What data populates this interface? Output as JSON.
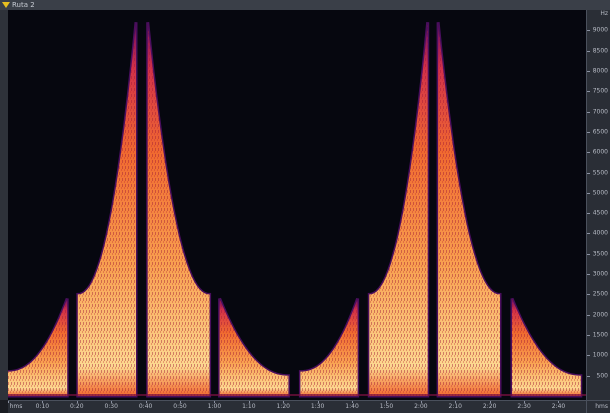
{
  "window": {
    "title": "Ruta 2",
    "icon": "triangle-marker-icon"
  },
  "chart_data": {
    "type": "heatmap",
    "colormap": [
      "#06070f",
      "#3a0a4a",
      "#8a1660",
      "#d2304a",
      "#f06a30",
      "#f8a050",
      "#fcd890"
    ],
    "y_axis": {
      "unit_label": "Hz",
      "range": [
        0,
        9500
      ],
      "ticks": [
        {
          "value": 9000,
          "label": "9000"
        },
        {
          "value": 8500,
          "label": "8500"
        },
        {
          "value": 8000,
          "label": "8000"
        },
        {
          "value": 7500,
          "label": "7500"
        },
        {
          "value": 7000,
          "label": "7000"
        },
        {
          "value": 6500,
          "label": "6500"
        },
        {
          "value": 6000,
          "label": "6000"
        },
        {
          "value": 5500,
          "label": "5500"
        },
        {
          "value": 5000,
          "label": "5000"
        },
        {
          "value": 4500,
          "label": "4500"
        },
        {
          "value": 4000,
          "label": "4000"
        },
        {
          "value": 3500,
          "label": "3500"
        },
        {
          "value": 3000,
          "label": "3000"
        },
        {
          "value": 2500,
          "label": "2500"
        },
        {
          "value": 2000,
          "label": "2000"
        },
        {
          "value": 1500,
          "label": "1500"
        },
        {
          "value": 1000,
          "label": "1000"
        },
        {
          "value": 500,
          "label": "500"
        }
      ]
    },
    "x_axis": {
      "range": [
        0,
        168
      ],
      "unit_label": "hms",
      "ticks": [
        {
          "value": 0,
          "label": "hms"
        },
        {
          "value": 10,
          "label": "0:10"
        },
        {
          "value": 20,
          "label": "0:20"
        },
        {
          "value": 30,
          "label": "0:30"
        },
        {
          "value": 40,
          "label": "0:40"
        },
        {
          "value": 50,
          "label": "0:50"
        },
        {
          "value": 60,
          "label": "1:00"
        },
        {
          "value": 70,
          "label": "1:10"
        },
        {
          "value": 80,
          "label": "1:20"
        },
        {
          "value": 90,
          "label": "1:30"
        },
        {
          "value": 100,
          "label": "1:40"
        },
        {
          "value": 110,
          "label": "1:50"
        },
        {
          "value": 120,
          "label": "2:00"
        },
        {
          "value": 130,
          "label": "2:10"
        },
        {
          "value": 140,
          "label": "2:20"
        },
        {
          "value": 150,
          "label": "2:30"
        },
        {
          "value": 160,
          "label": "2:40"
        }
      ]
    },
    "segments": [
      {
        "t_start": 0,
        "t_end": 17.2,
        "f_top_start": 600,
        "f_top_end": 2400
      },
      {
        "t_start": 20.3,
        "t_end": 37.2,
        "f_top_start": 2500,
        "f_top_end": 9200
      },
      {
        "t_start": 40.6,
        "t_end": 58.6,
        "f_top_start": 9200,
        "f_top_end": 2500
      },
      {
        "t_start": 61.5,
        "t_end": 81.5,
        "f_top_start": 2400,
        "f_top_end": 500
      },
      {
        "t_start": 85.0,
        "t_end": 101.6,
        "f_top_start": 600,
        "f_top_end": 2400
      },
      {
        "t_start": 105.0,
        "t_end": 122.0,
        "f_top_start": 2500,
        "f_top_end": 9200
      },
      {
        "t_start": 125.0,
        "t_end": 143.0,
        "f_top_start": 9200,
        "f_top_end": 2500
      },
      {
        "t_start": 146.5,
        "t_end": 166.5,
        "f_top_start": 2400,
        "f_top_end": 500
      }
    ]
  }
}
